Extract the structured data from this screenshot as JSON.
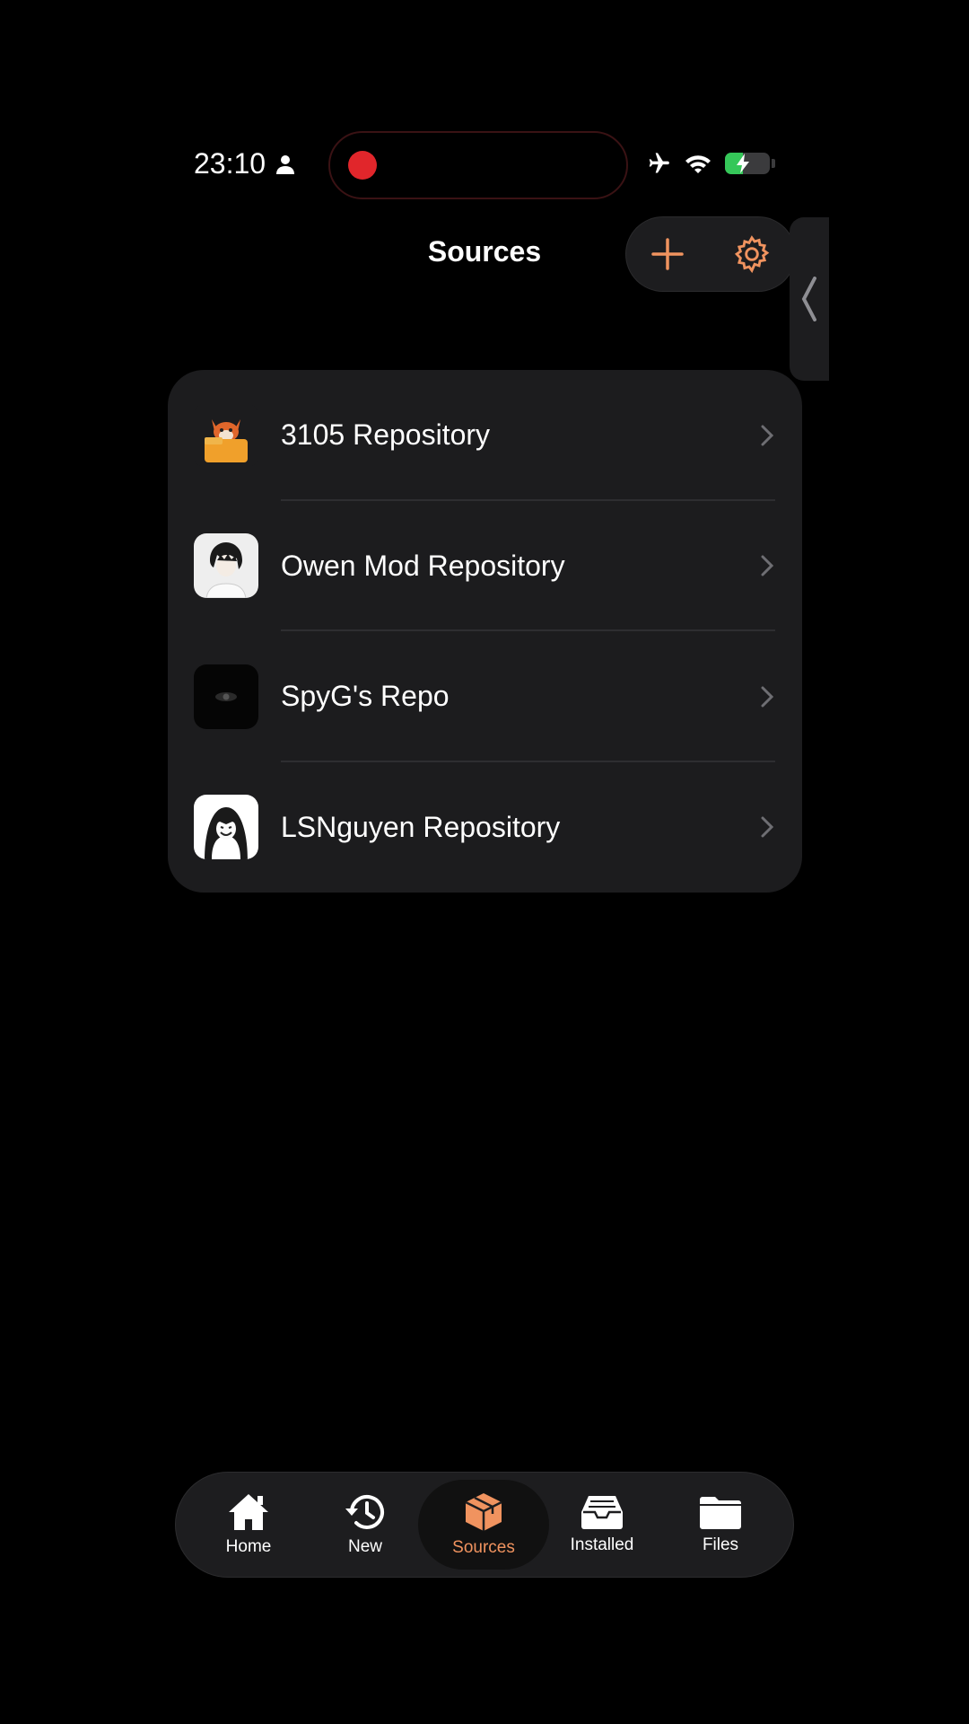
{
  "status_bar": {
    "time": "23:10"
  },
  "header": {
    "title": "Sources"
  },
  "sources": [
    {
      "name": "3105 Repository"
    },
    {
      "name": "Owen Mod Repository"
    },
    {
      "name": "SpyG's Repo"
    },
    {
      "name": "LSNguyen Repository"
    }
  ],
  "tabs": [
    {
      "label": "Home",
      "icon": "house-icon"
    },
    {
      "label": "New",
      "icon": "clock-history-icon"
    },
    {
      "label": "Sources",
      "icon": "package-icon",
      "active": true
    },
    {
      "label": "Installed",
      "icon": "tray-icon"
    },
    {
      "label": "Files",
      "icon": "folder-icon"
    }
  ],
  "colors": {
    "accent": "#f0935f",
    "background": "#000000",
    "card": "#1c1c1e"
  }
}
